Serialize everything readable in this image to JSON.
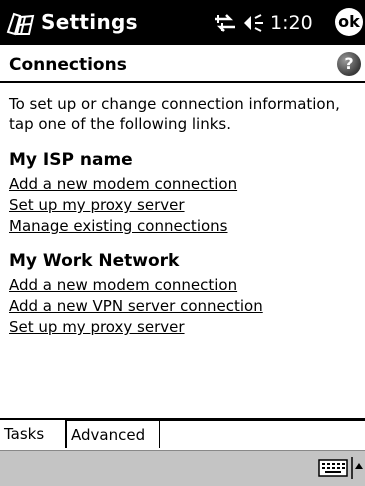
{
  "titlebar": {
    "title": "Settings",
    "clock": "1:20",
    "ok_label": "ok",
    "icons": [
      "start-flag-icon",
      "connectivity-icon",
      "volume-icon"
    ]
  },
  "page": {
    "title": "Connections",
    "help_label": "?"
  },
  "content": {
    "intro": "To set up or change connection information, tap one of the following links.",
    "sections": [
      {
        "heading": "My ISP name",
        "links": [
          "Add a new modem connection",
          "Set up my proxy server",
          "Manage existing connections"
        ]
      },
      {
        "heading": "My Work Network",
        "links": [
          "Add a new modem connection",
          "Add a new VPN server connection",
          "Set up my proxy server"
        ]
      }
    ]
  },
  "tabs": [
    "Tasks",
    "Advanced"
  ],
  "commandbar": {
    "icons": [
      "keyboard-icon",
      "input-menu-arrow-icon"
    ]
  }
}
